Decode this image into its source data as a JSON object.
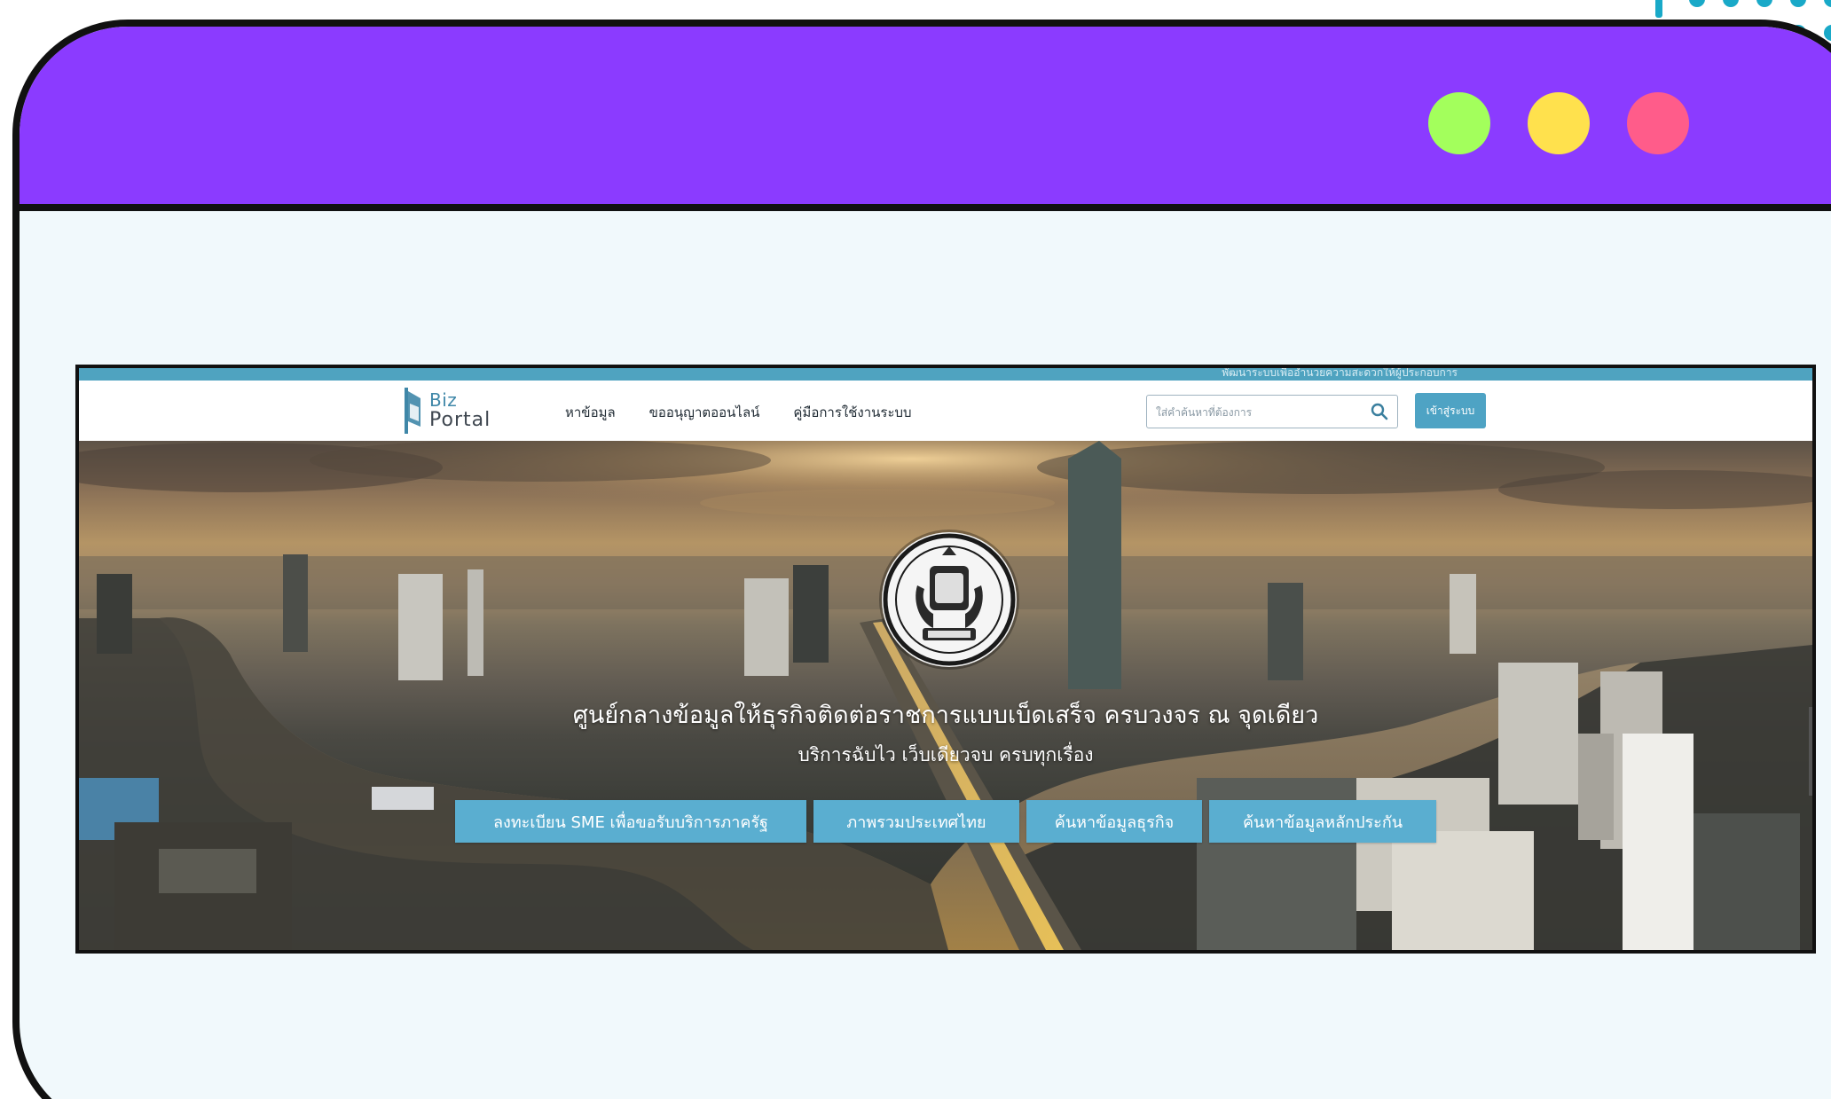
{
  "colors": {
    "titlebar": "#8b3bff",
    "content_bg": "#f1f9fc",
    "frame_border": "#111111",
    "traffic_green": "#a3ff5c",
    "traffic_yellow": "#ffe14d",
    "traffic_pink": "#ff5c8a",
    "portal_accent": "#4ea3c4",
    "decor_dots": "#19a9c8"
  },
  "window": {
    "controls": [
      "green-dot",
      "yellow-dot",
      "pink-dot"
    ]
  },
  "site": {
    "logo": {
      "line1": "Biz",
      "line2": "Portal"
    },
    "top_strip_text": "พัฒนาระบบเพื่ออำนวยความสะดวกให้ผู้ประกอบการ",
    "nav": [
      {
        "label": "หาข้อมูล"
      },
      {
        "label": "ขออนุญาตออนไลน์"
      },
      {
        "label": "คู่มือการใช้งานระบบ"
      }
    ],
    "search": {
      "placeholder": "ใส่คำค้นหาที่ต้องการ",
      "value": "",
      "icon": "search-icon"
    },
    "login_label": "เข้าสู่ระบบ",
    "hero": {
      "title": "ศูนย์กลางข้อมูลให้ธุรกิจติดต่อราชการแบบเบ็ดเสร็จ ครบวงจร ณ จุดเดียว",
      "subtitle": "บริการฉับไว เว็บเดียวจบ ครบทุกเรื่อง",
      "emblem_icon": "government-emblem-icon",
      "buttons": [
        {
          "label": "ลงทะเบียน SME เพื่อขอรับบริการภาครัฐ"
        },
        {
          "label": "ภาพรวมประเทศไทย"
        },
        {
          "label": "ค้นหาข้อมูลธุรกิจ"
        },
        {
          "label": "ค้นหาข้อมูลหลักประกัน"
        }
      ]
    }
  }
}
